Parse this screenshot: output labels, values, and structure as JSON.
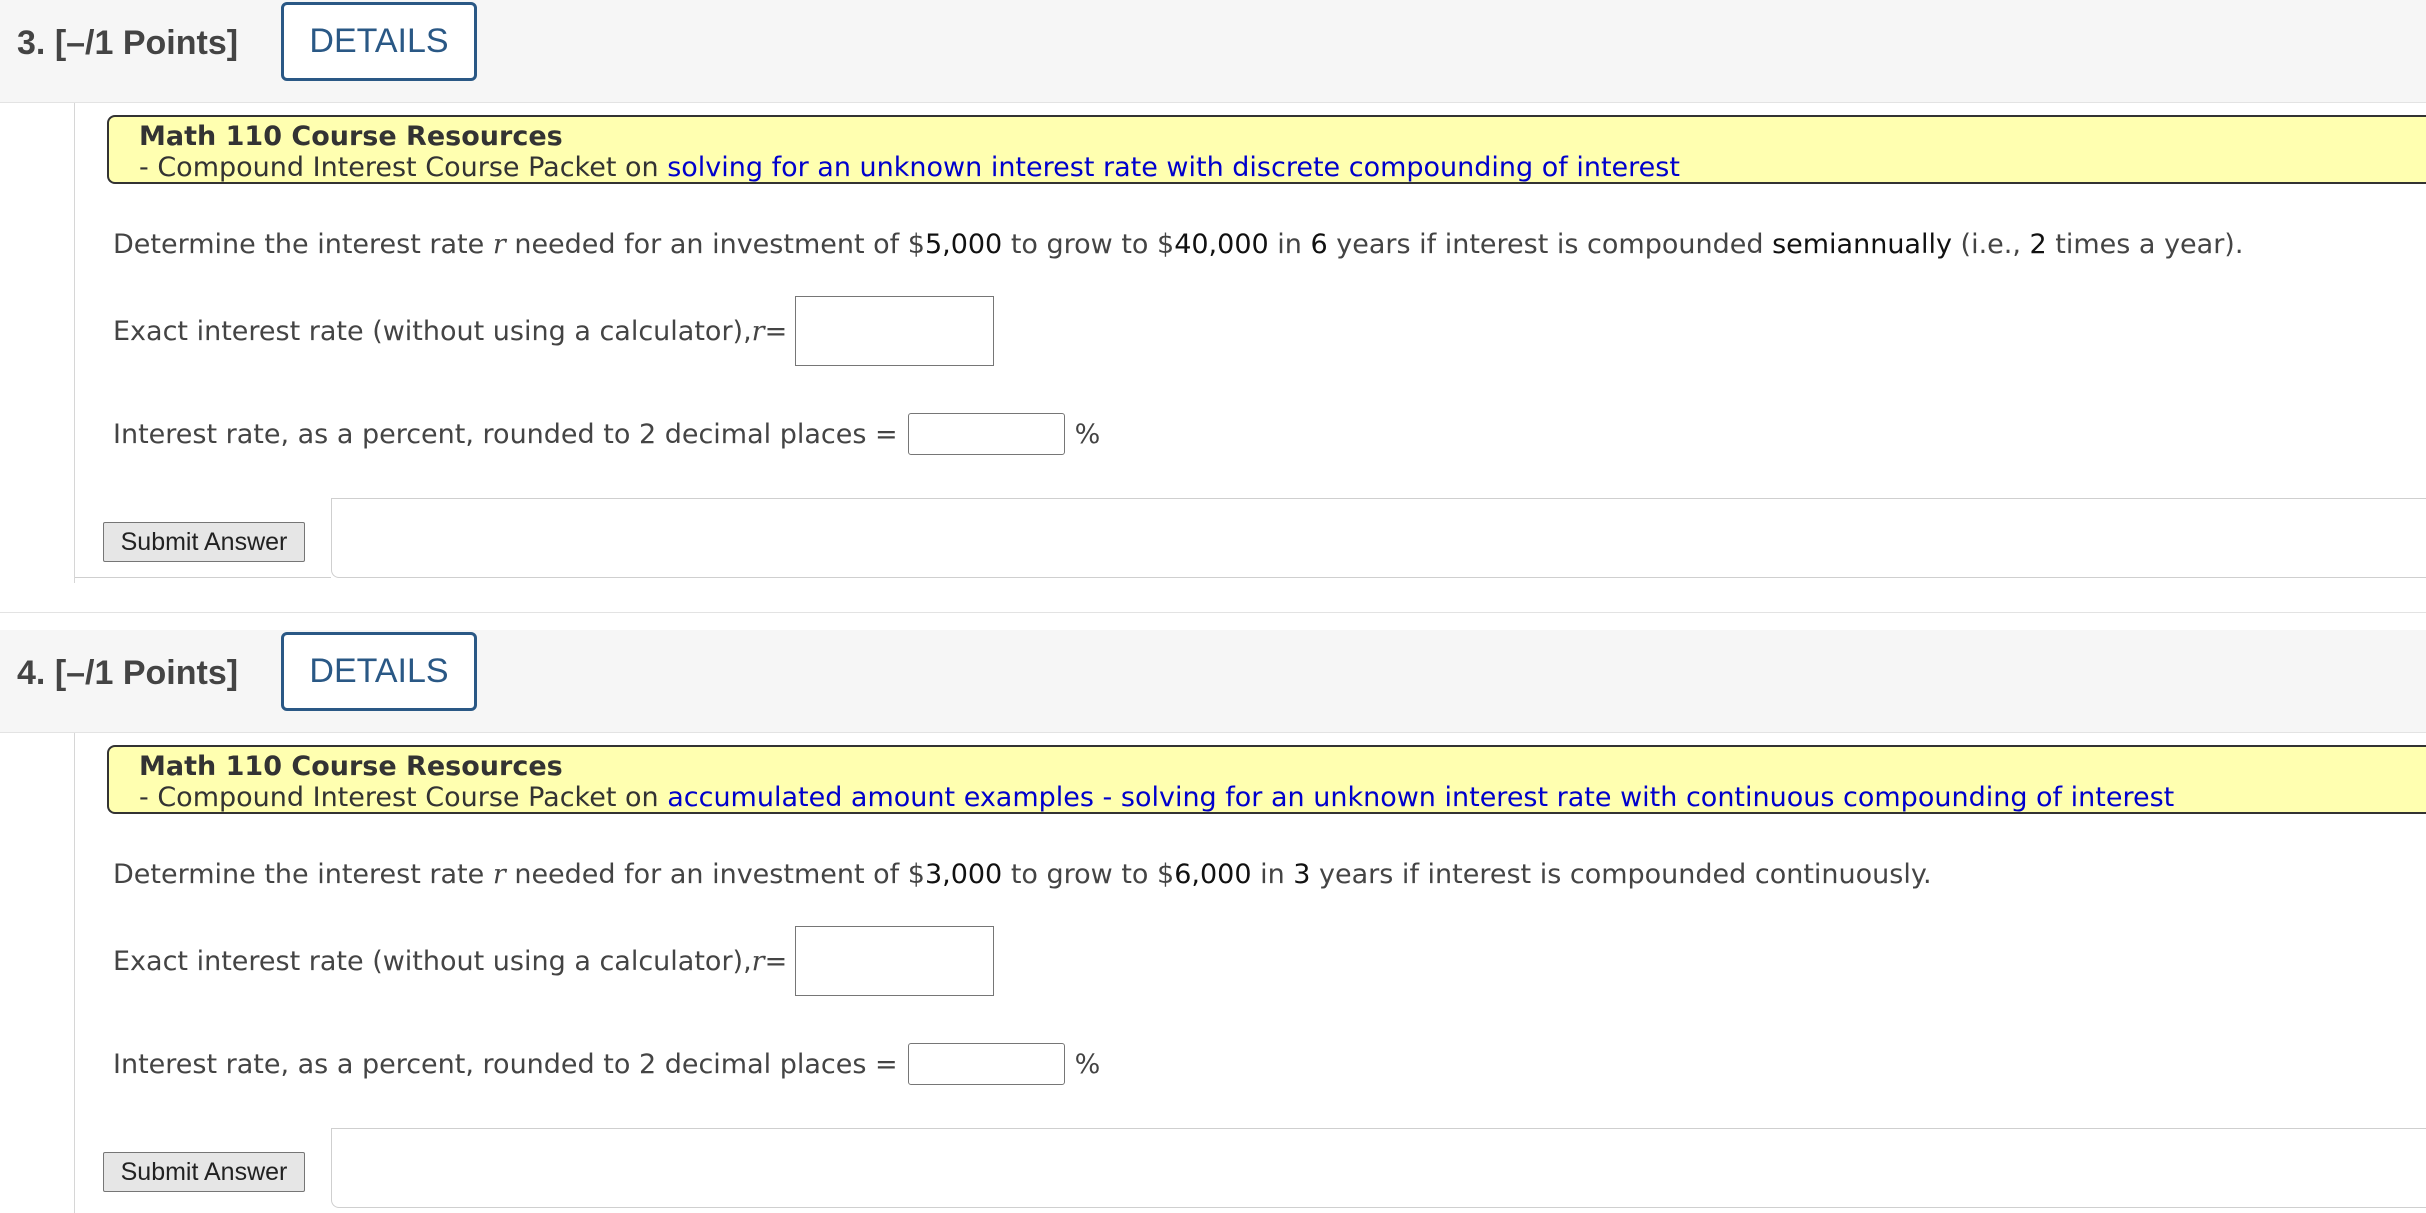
{
  "questions": [
    {
      "number": "3.",
      "points": "[–/1 Points]",
      "details_label": "DETAILS",
      "resources": {
        "title": "Math 110 Course Resources",
        "line_prefix": "- Compound Interest Course Packet on ",
        "link_text": "solving for an unknown interest rate with discrete compounding of interest"
      },
      "prompt": {
        "p1": "Determine the interest rate ",
        "var": "r",
        "p2": " needed for an investment of $",
        "principal": "5,000",
        "p3": " to grow to $",
        "target": "40,000",
        "p4": " in ",
        "years": "6",
        "p5": " years if interest is compounded ",
        "compounding": "semiannually",
        "p6": " (i.e., ",
        "times": "2",
        "p7": " times a year)."
      },
      "exact_label": "Exact interest rate (without using a calculator), ",
      "exact_var": "r",
      "exact_eq": " =",
      "percent_label": "Interest rate, as a percent, rounded to 2 decimal places =",
      "percent_unit": "%",
      "submit_label": "Submit Answer"
    },
    {
      "number": "4.",
      "points": "[–/1 Points]",
      "details_label": "DETAILS",
      "resources": {
        "title": "Math 110 Course Resources",
        "line_prefix": "- Compound Interest Course Packet on ",
        "link_text": "accumulated amount examples - solving for an unknown interest rate with continuous compounding of interest"
      },
      "prompt": {
        "p1": "Determine the interest rate ",
        "var": "r",
        "p2": " needed for an investment of $",
        "principal": "3,000",
        "p3": " to grow to $",
        "target": "6,000",
        "p4": " in ",
        "years": "3",
        "p5": " years if interest is compounded continuously."
      },
      "exact_label": "Exact interest rate (without using a calculator), ",
      "exact_var": "r",
      "exact_eq": " =",
      "percent_label": "Interest rate, as a percent, rounded to 2 decimal places =",
      "percent_unit": "%",
      "submit_label": "Submit Answer"
    }
  ]
}
